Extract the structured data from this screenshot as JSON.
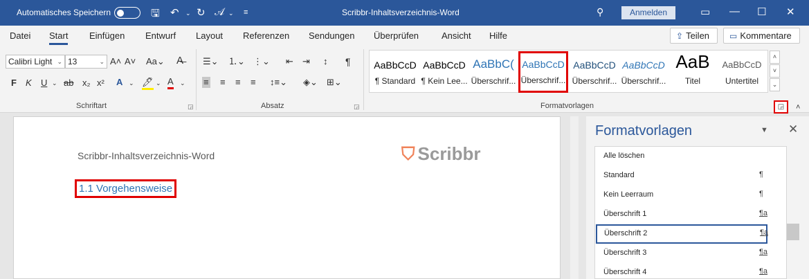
{
  "titlebar": {
    "autosave_label": "Automatisches Speichern",
    "doc_title": "Scribbr-Inhaltsverzeichnis-Word",
    "signin_label": "Anmelden"
  },
  "menu": {
    "tabs": [
      "Datei",
      "Start",
      "Einfügen",
      "Entwurf",
      "Layout",
      "Referenzen",
      "Sendungen",
      "Überprüfen",
      "Ansicht",
      "Hilfe"
    ],
    "active_tab": "Start",
    "share_label": "Teilen",
    "comments_label": "Kommentare"
  },
  "ribbon": {
    "font_name": "Calibri Light",
    "font_size": "13",
    "group_font": "Schriftart",
    "group_paragraph": "Absatz",
    "group_styles": "Formatvorlagen",
    "styles": [
      {
        "preview": "AaBbCcD",
        "name": "¶ Standard"
      },
      {
        "preview": "AaBbCcD",
        "name": "¶ Kein Lee..."
      },
      {
        "preview": "AaBbC(",
        "name": "Überschrif..."
      },
      {
        "preview": "AaBbCcD",
        "name": "Überschrif..."
      },
      {
        "preview": "AaBbCcD",
        "name": "Überschrif..."
      },
      {
        "preview": "AaBbCcD",
        "name": "Überschrif..."
      },
      {
        "preview": "AaB",
        "name": "Titel"
      },
      {
        "preview": "AaBbCcD",
        "name": "Untertitel"
      }
    ],
    "selected_style_index": 3
  },
  "document": {
    "header_text": "Scribbr-Inhaltsverzeichnis-Word",
    "logo_text": "Scribbr",
    "heading_text": "1.1 Vorgehensweise"
  },
  "pane": {
    "title": "Formatvorlagen",
    "items": [
      {
        "label": "Alle löschen",
        "mark": ""
      },
      {
        "label": "Standard",
        "mark": "¶"
      },
      {
        "label": "Kein Leerraum",
        "mark": "¶"
      },
      {
        "label": "Überschrift 1",
        "mark": "¶a"
      },
      {
        "label": "Überschrift 2",
        "mark": "¶a"
      },
      {
        "label": "Überschrift 3",
        "mark": "¶a"
      },
      {
        "label": "Überschrift 4",
        "mark": "¶a"
      }
    ],
    "selected_index": 4
  }
}
